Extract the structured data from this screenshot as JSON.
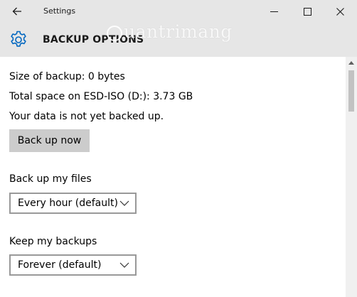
{
  "window": {
    "title": "Settings"
  },
  "header": {
    "title": "BACKUP OPTIONS",
    "icon": "gear-icon",
    "accent_color": "#0067c0"
  },
  "watermark": {
    "text": "uantrimang"
  },
  "info": {
    "size_line": "Size of backup: 0 bytes",
    "space_line": "Total space on ESD-ISO (D:): 3.73 GB",
    "status_line": "Your data is not yet backed up."
  },
  "actions": {
    "backup_now_label": "Back up now"
  },
  "backup_files": {
    "label": "Back up my files",
    "selected": "Every hour (default)"
  },
  "keep_backups": {
    "label": "Keep my backups",
    "selected": "Forever (default)"
  },
  "colors": {
    "title_bar_bg": "#e6e6e6",
    "button_bg": "#cccccc",
    "select_border": "#999999"
  }
}
